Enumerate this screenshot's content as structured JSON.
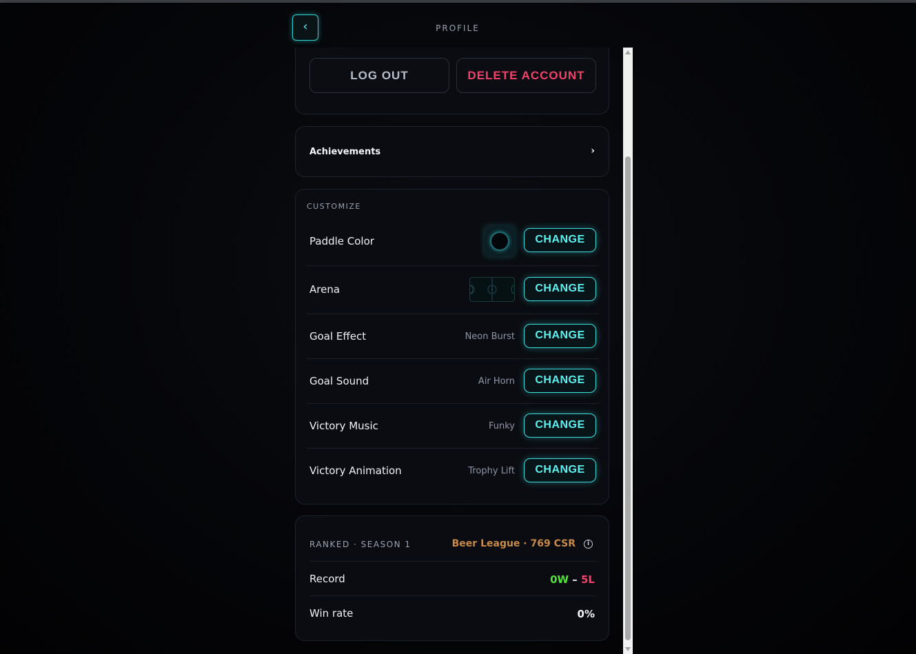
{
  "header": {
    "back_icon": "chevron-left-icon",
    "back_glyph": "‹",
    "title": "PROFILE"
  },
  "account": {
    "logout_label": "LOG OUT",
    "delete_label": "DELETE ACCOUNT"
  },
  "achievements": {
    "label": "Achievements",
    "chevron": "›"
  },
  "customize": {
    "section_label": "CUSTOMIZE",
    "change_label": "CHANGE",
    "rows": [
      {
        "label": "Paddle Color",
        "value": ""
      },
      {
        "label": "Arena",
        "value": ""
      },
      {
        "label": "Goal Effect",
        "value": "Neon Burst"
      },
      {
        "label": "Goal Sound",
        "value": "Air Horn"
      },
      {
        "label": "Victory Music",
        "value": "Funky"
      },
      {
        "label": "Victory Animation",
        "value": "Trophy Lift"
      }
    ]
  },
  "ranked": {
    "heading": "RANKED · SEASON 1",
    "tier": "Beer League · 769 CSR",
    "info_glyph": "i",
    "record_label": "Record",
    "wins": "0W",
    "separator": " – ",
    "losses": "5L",
    "winrate_label": "Win rate",
    "winrate_value": "0%"
  },
  "colors": {
    "accent": "#3ce0e0",
    "danger": "#f2436b",
    "win": "#52e23a",
    "tier": "#c98a4a",
    "background": "#050609"
  }
}
